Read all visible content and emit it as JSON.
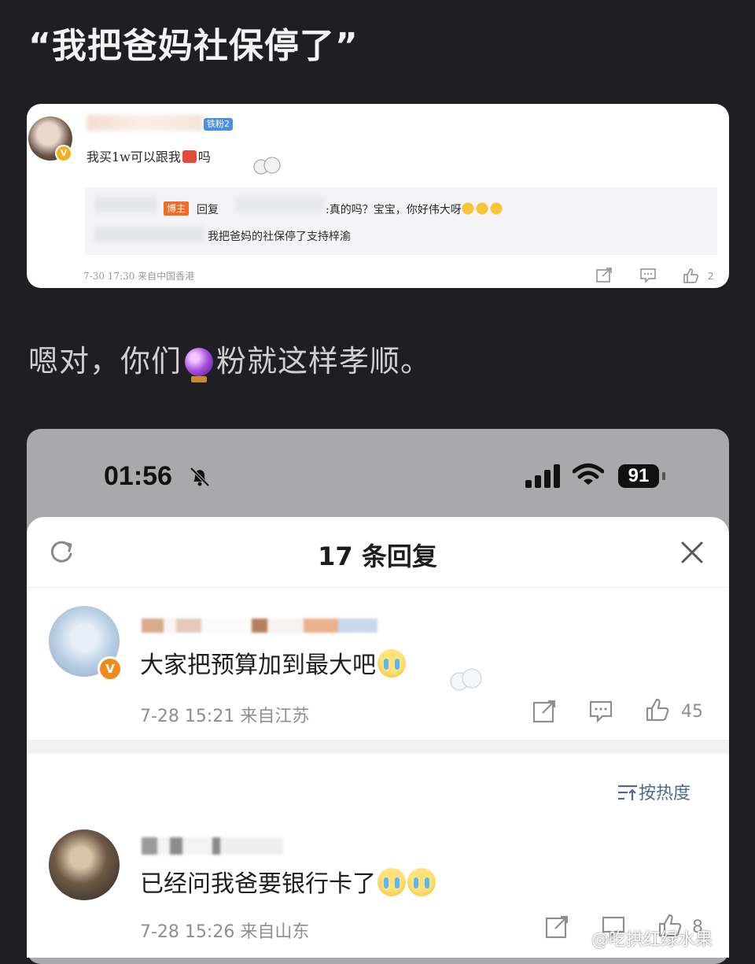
{
  "post": {
    "title": "“我把爸妈社保停了”",
    "middle_text_a": "嗯对，你们",
    "middle_text_b": "粉就这样孝顺。"
  },
  "card1": {
    "fan_badge": "铁粉2",
    "comment": "我买1w可以跟我",
    "comment_tail": "吗",
    "boss_tag": "博主",
    "reply_label": "回复",
    "reply_rest": ":真的吗？宝宝，你好伟大呀",
    "reply_line2": "我把爸妈的社保停了支持梓渝",
    "meta": "7-30 17:30 来自中国香港",
    "like_count": "2",
    "icons": [
      "share-icon",
      "comment-icon",
      "like-icon"
    ]
  },
  "phone": {
    "status_time": "01:56",
    "battery": "91",
    "sheet_title": "17 条回复",
    "sort_label": "按热度",
    "comments": [
      {
        "text": "大家把预算加到最大吧",
        "meta": "7-28 15:21 来自江苏",
        "likes": "45"
      },
      {
        "text": "已经问我爸要银行卡了",
        "meta": "7-28 15:26 来自山东",
        "likes": "8"
      }
    ]
  },
  "watermark": "@吃拱红绿水果",
  "colors": {
    "background": "#1f1e23",
    "accent_orange": "#f36b24",
    "sort_blue": "#4b6a8d"
  }
}
